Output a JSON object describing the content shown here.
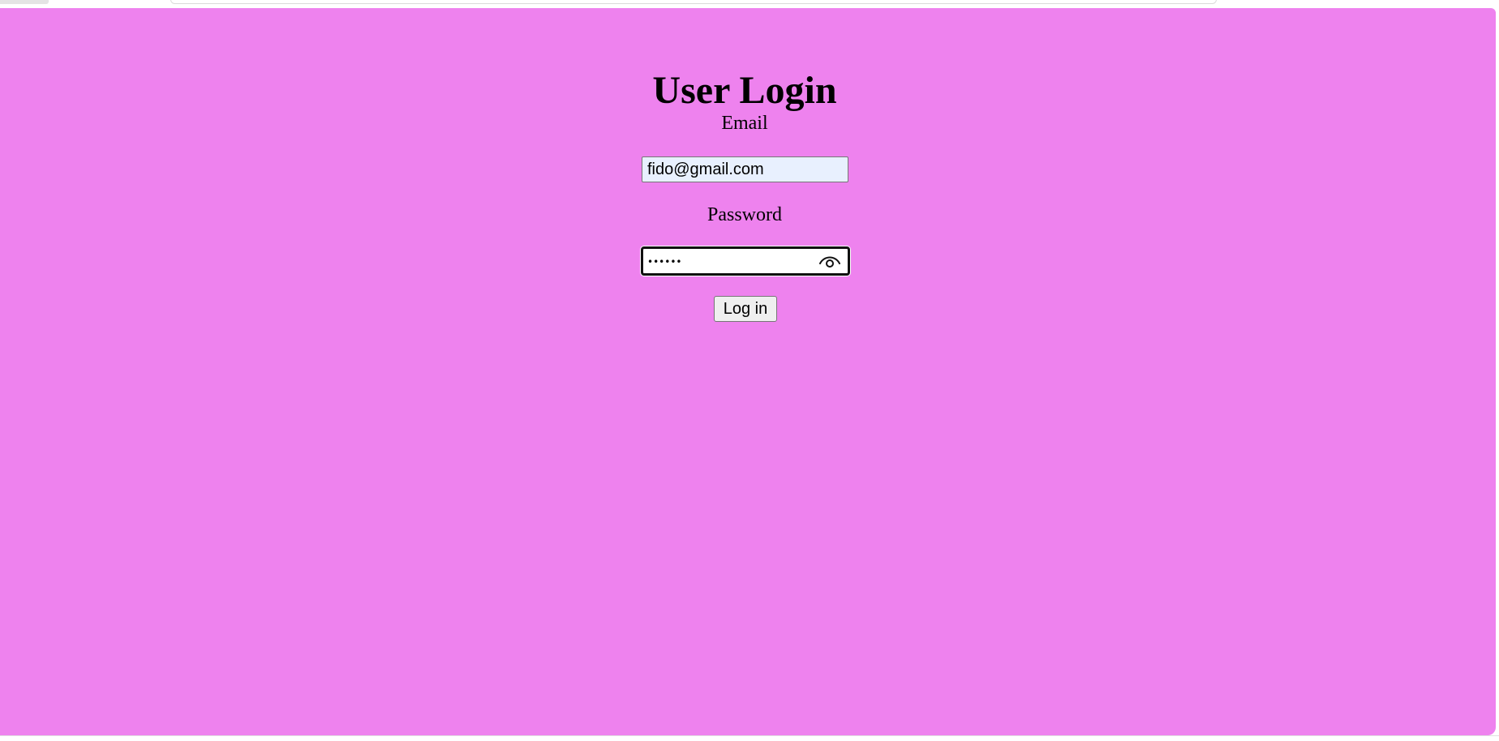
{
  "page": {
    "title": "User Login",
    "background_color": "#ee82ee"
  },
  "email": {
    "label": "Email",
    "value": "fido@gmail.com"
  },
  "password": {
    "label": "Password",
    "masked_value": "••••••",
    "toggle_icon": "eye-icon"
  },
  "actions": {
    "login_label": "Log in"
  }
}
